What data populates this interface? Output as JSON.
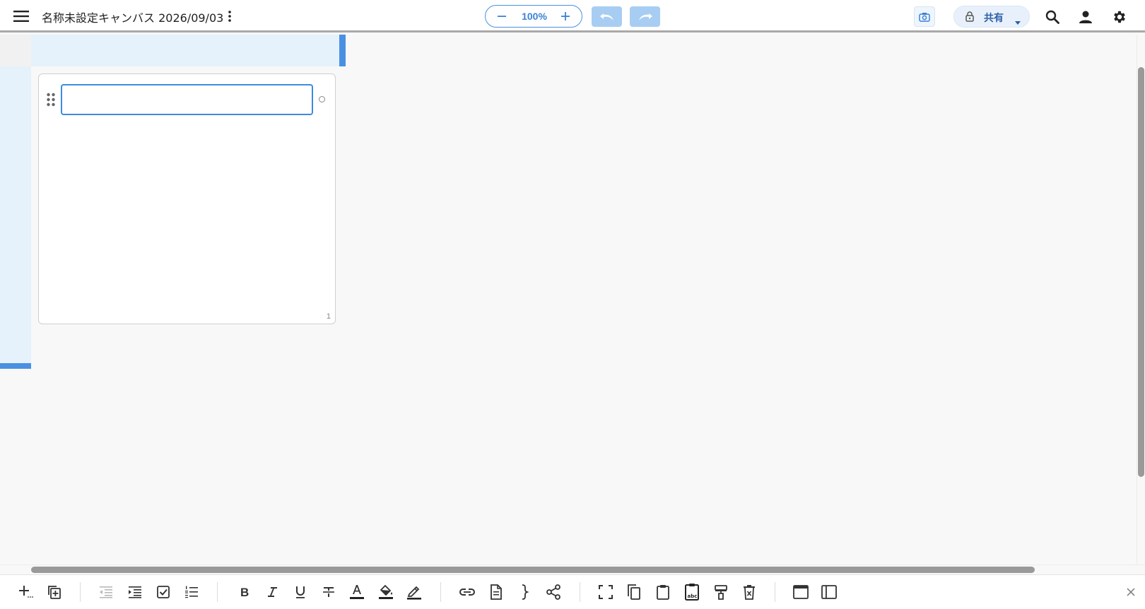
{
  "header": {
    "title": "名称未設定キャンバス 2026/09/03",
    "zoom": "100%",
    "share_label": "共有",
    "icons": [
      "menu-icon",
      "more-vert-icon",
      "zoom-out-icon",
      "zoom-in-icon",
      "undo-icon",
      "redo-icon",
      "camera-icon",
      "lock-icon",
      "dropdown-icon",
      "search-icon",
      "account-icon",
      "settings-icon"
    ]
  },
  "canvas": {
    "card": {
      "input_value": "",
      "page_number": "1"
    }
  },
  "toolbar": {
    "groups": [
      [
        "add-icon",
        "duplicate-icon"
      ],
      [
        "outdent-icon",
        "indent-icon",
        "checkbox-icon",
        "numbered-list-icon"
      ],
      [
        "bold-icon",
        "italic-icon",
        "underline-icon",
        "strikethrough-icon",
        "text-color-icon",
        "fill-color-icon",
        "highlight-icon"
      ],
      [
        "link-icon",
        "document-icon",
        "brace-icon",
        "connector-icon"
      ],
      [
        "select-frame-icon",
        "copy-icon",
        "paste-icon",
        "paste-text-icon",
        "format-painter-icon",
        "delete-icon"
      ],
      [
        "window-icon",
        "sidebar-icon"
      ]
    ],
    "close_icon": "close-icon"
  },
  "colors": {
    "accent": "#4a90e2",
    "band": "#e5f1fb",
    "undo_bg": "#a8cdf2"
  }
}
